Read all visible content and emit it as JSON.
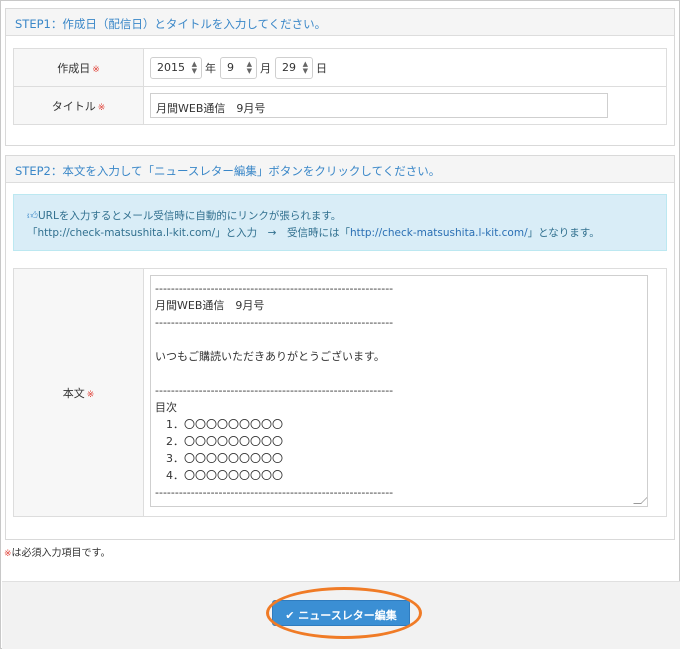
{
  "step1": {
    "heading": "STEP1：作成日（配信日）とタイトルを入力してください。",
    "date_label": "作成日",
    "required_mark": "※",
    "year": "2015",
    "year_unit": "年",
    "month": "9",
    "month_unit": "月",
    "day": "29",
    "day_unit": "日",
    "title_label": "タイトル",
    "title_value": "月間WEB通信　9月号"
  },
  "step2": {
    "heading": "STEP2：本文を入力して「ニュースレター編集」ボタンをクリックしてください。",
    "info_line1": "URLを入力するとメール受信時に自動的にリンクが張られます。",
    "info_line2_a": "「http://check-matsushita.l-kit.com/」と入力　→　受信時には「",
    "info_line2_link": "http://check-matsushita.l-kit.com/",
    "info_line2_b": "」となります。",
    "body_label": "本文",
    "body_text": "------------------------------------------------------------\n月間WEB通信　9月号\n------------------------------------------------------------\n\nいつもご購読いただきありがとうございます。\n\n------------------------------------------------------------\n目次\n　1．〇〇〇〇〇〇〇〇〇\n　2．〇〇〇〇〇〇〇〇〇\n　3．〇〇〇〇〇〇〇〇〇\n　4．〇〇〇〇〇〇〇〇〇\n------------------------------------------------------------"
  },
  "note": {
    "mark": "※",
    "text": "は必須入力項目です。"
  },
  "footer": {
    "submit_label": "ニュースレター編集"
  },
  "colors": {
    "accent": "#3a87c8",
    "button": "#3b8fd4",
    "highlight_ring": "#f07b26",
    "required": "#e0443a"
  }
}
